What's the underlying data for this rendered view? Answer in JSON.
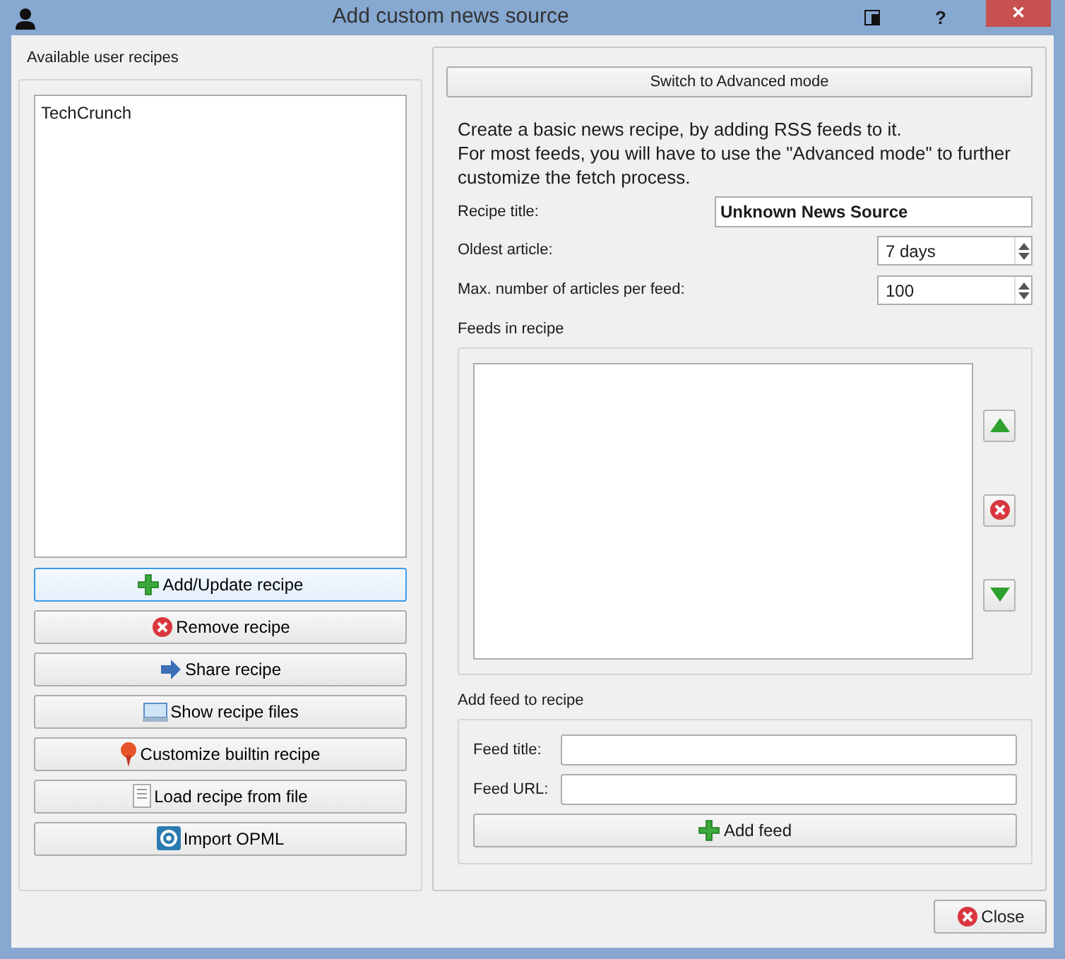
{
  "window": {
    "title": "Add custom news source",
    "buttons": [
      {
        "kind": "restore"
      },
      {
        "kind": "help",
        "label": "?"
      },
      {
        "kind": "close",
        "label": "✕"
      }
    ]
  },
  "left": {
    "label": "Available user recipes",
    "recipes": [
      {
        "name": "TechCrunch",
        "selected": false
      }
    ],
    "buttons": [
      {
        "label": "Add/Update recipe",
        "kind": "plus",
        "focused": true
      },
      {
        "label": "Remove recipe",
        "kind": "remove",
        "focused": false
      },
      {
        "label": "Share recipe",
        "kind": "arrow",
        "focused": false
      },
      {
        "label": "Show recipe files",
        "kind": "drive",
        "focused": false
      },
      {
        "label": "Customize builtin recipe",
        "kind": "pin",
        "focused": false
      },
      {
        "label": "Load recipe from file",
        "kind": "doc",
        "focused": false
      },
      {
        "label": "Import OPML",
        "kind": "opml",
        "focused": false
      }
    ]
  },
  "right": {
    "mode_button": "Switch to Advanced mode",
    "intro": [
      "Create a basic news recipe, by adding RSS feeds to it.",
      "For most feeds, you will have to use the \"Advanced mode\" to further customize the fetch process."
    ],
    "recipe_title": {
      "label": "Recipe title:",
      "value": "Unknown News Source"
    },
    "oldest_article": {
      "label": "Oldest article:",
      "value": "7 days"
    },
    "max_articles": {
      "label": "Max. number of articles per feed:",
      "value": "100"
    },
    "feeds": {
      "label": "Feeds in recipe",
      "buttons": [
        {
          "kind": "up"
        },
        {
          "kind": "remove"
        },
        {
          "kind": "down"
        }
      ]
    },
    "add_feed": {
      "label": "Add feed to recipe",
      "feed_title": {
        "label": "Feed title:"
      },
      "feed_url": {
        "label": "Feed URL:"
      },
      "button": "Add feed"
    }
  },
  "close_button": "Close"
}
